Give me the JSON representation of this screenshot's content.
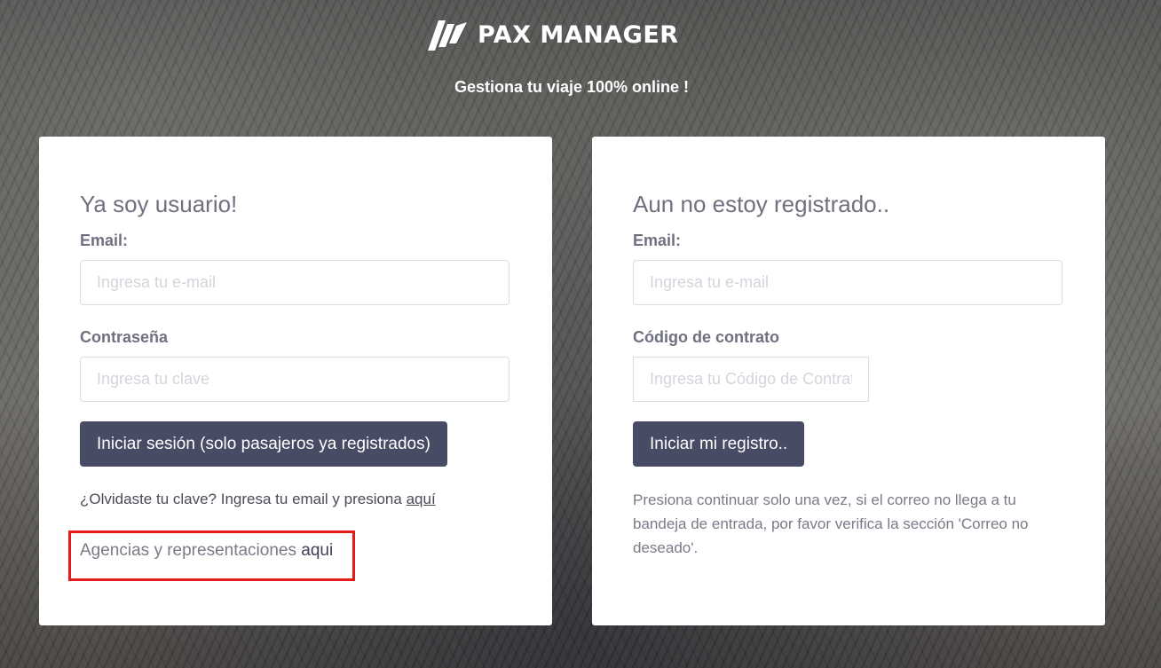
{
  "header": {
    "logo_text": "PAX MANAGER",
    "tagline": "Gestiona tu viaje 100% online !"
  },
  "login": {
    "title": "Ya soy usuario!",
    "email_label": "Email:",
    "email_placeholder": "Ingresa tu e-mail",
    "password_label": "Contraseña",
    "password_placeholder": "Ingresa tu clave",
    "submit_label": "Iniciar sesión (solo pasajeros ya registrados)",
    "forgot_text": "¿Olvidaste tu clave? Ingresa tu email y presiona",
    "forgot_link": "aquí",
    "agencies_text": "Agencias y representaciones",
    "agencies_link": "aqui"
  },
  "register": {
    "title": "Aun no estoy registrado..",
    "email_label": "Email:",
    "email_placeholder": "Ingresa tu e-mail",
    "contract_label": "Código de contrato",
    "contract_placeholder": "Ingresa tu Código de Contrato",
    "submit_label": "Iniciar mi registro..",
    "notice": "Presiona continuar solo una vez, si el correo no llega a tu bandeja de entrada, por favor verifica la sección 'Correo no deseado'."
  },
  "colors": {
    "button_bg": "#474b63",
    "highlight_border": "#e41b1b",
    "card_bg": "#ffffff"
  }
}
